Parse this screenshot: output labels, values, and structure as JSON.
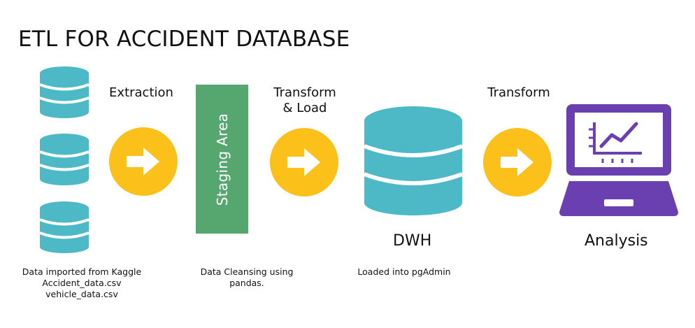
{
  "title": "ETL FOR ACCIDENT DATABASE",
  "steps": {
    "extraction": "Extraction",
    "transform_load_line1": "Transform",
    "transform_load_line2": "& Load",
    "transform": "Transform"
  },
  "staging_area": "Staging Area",
  "dwh_label": "DWH",
  "analysis_label": "Analysis",
  "notes": {
    "source_line1": "Data imported from Kaggle",
    "source_line2": "Accident_data.csv",
    "source_line3": "vehicle_data.csv",
    "cleansing_line1": "Data Cleansing using",
    "cleansing_line2": "pandas.",
    "loaded": "Loaded into pgAdmin"
  },
  "colors": {
    "database": "#4db9c6",
    "arrow_circle": "#fbc11a",
    "staging": "#56a66f",
    "laptop": "#6a3fb0"
  },
  "icons": [
    "database-icon",
    "arrow-right-icon",
    "laptop-chart-icon"
  ]
}
